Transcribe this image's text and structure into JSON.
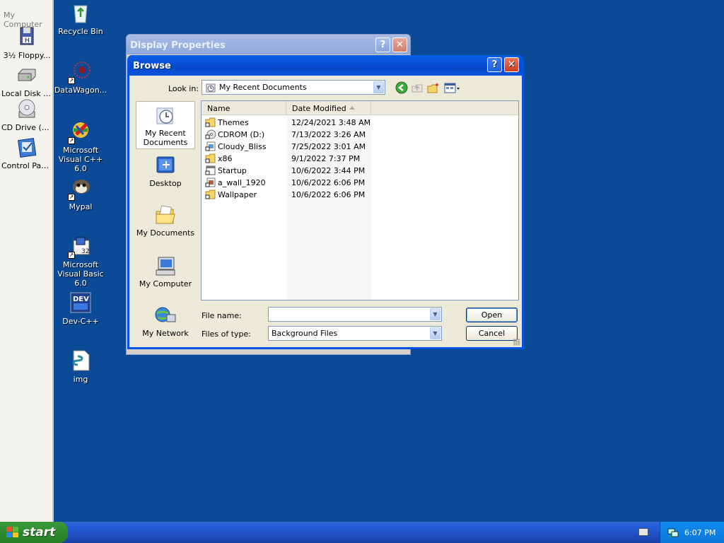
{
  "left_panel": {
    "title": "My Computer",
    "items": [
      {
        "label": "3½ Floppy...",
        "icon": "floppy-drive-icon"
      },
      {
        "label": "Local Disk (...",
        "icon": "hard-disk-icon"
      },
      {
        "label": "CD Drive (D:)",
        "icon": "cd-drive-icon"
      },
      {
        "label": "Control Panel",
        "icon": "control-panel-icon"
      }
    ]
  },
  "desktop": {
    "icons": [
      {
        "label": "Recycle Bin",
        "icon": "recycle-bin-icon"
      },
      {
        "label": "DataWagon...",
        "icon": "datawagon-icon"
      },
      {
        "label": "Microsoft Visual C++ 6.0",
        "icon": "visual-cpp-icon"
      },
      {
        "label": "Mypal",
        "icon": "mypal-icon"
      },
      {
        "label": "Microsoft Visual Basic 6.0",
        "icon": "visual-basic-icon"
      },
      {
        "label": "Dev-C++",
        "icon": "dev-cpp-icon"
      },
      {
        "label": "img",
        "icon": "script-file-icon"
      }
    ]
  },
  "bg_window": {
    "title": "Display Properties"
  },
  "dialog": {
    "title": "Browse",
    "help_symbol": "?",
    "close_symbol": "✕",
    "look_in_label": "Look in:",
    "look_in_value": "My Recent Documents",
    "places": [
      {
        "label": "My Recent Documents",
        "icon": "recent-documents-icon"
      },
      {
        "label": "Desktop",
        "icon": "desktop-icon"
      },
      {
        "label": "My Documents",
        "icon": "my-documents-icon"
      },
      {
        "label": "My Computer",
        "icon": "my-computer-icon"
      },
      {
        "label": "My Network",
        "icon": "my-network-icon"
      }
    ],
    "columns": {
      "name": "Name",
      "date_modified": "Date Modified"
    },
    "files": [
      {
        "name": "Themes",
        "date": "12/24/2021 3:48 AM",
        "icon": "folder-shortcut-icon"
      },
      {
        "name": "CDROM (D:)",
        "date": "7/13/2022 3:26 AM",
        "icon": "cd-shortcut-icon"
      },
      {
        "name": "Cloudy_Bliss",
        "date": "7/25/2022 3:01 AM",
        "icon": "image-shortcut-icon"
      },
      {
        "name": "x86",
        "date": "9/1/2022 7:37 PM",
        "icon": "folder-shortcut-icon"
      },
      {
        "name": "Startup",
        "date": "10/6/2022 3:44 PM",
        "icon": "window-shortcut-icon"
      },
      {
        "name": "a_wall_1920",
        "date": "10/6/2022 6:06 PM",
        "icon": "image-shortcut-icon"
      },
      {
        "name": "Wallpaper",
        "date": "10/6/2022 6:06 PM",
        "icon": "folder-shortcut-icon"
      }
    ],
    "file_name_label": "File name:",
    "file_name_value": "",
    "files_of_type_label": "Files of type:",
    "files_of_type_value": "Background Files",
    "open_label": "Open",
    "cancel_label": "Cancel"
  },
  "taskbar": {
    "start_label": "start",
    "clock": "6:07 PM"
  },
  "colors": {
    "desktop": "#0a4a97",
    "title_active": "#0553e0",
    "start_green": "#2f8a2f"
  }
}
